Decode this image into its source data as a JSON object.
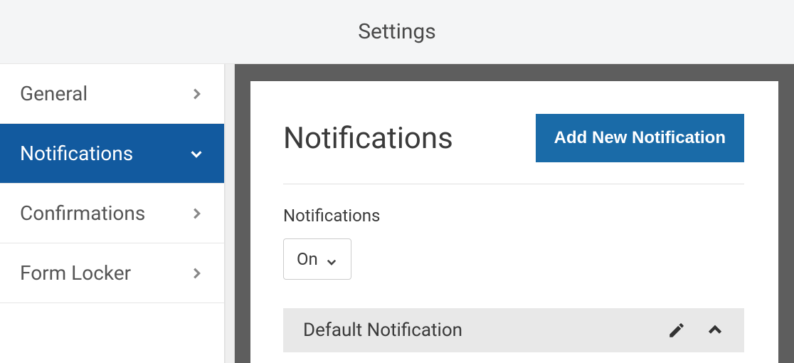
{
  "header": {
    "title": "Settings"
  },
  "sidebar": {
    "items": [
      {
        "label": "General"
      },
      {
        "label": "Notifications"
      },
      {
        "label": "Confirmations"
      },
      {
        "label": "Form Locker"
      }
    ]
  },
  "main": {
    "panel_title": "Notifications",
    "add_button": "Add New Notification",
    "section_label": "Notifications",
    "dropdown_value": "On",
    "item_title": "Default Notification"
  },
  "colors": {
    "accent": "#1a6ba8",
    "annotation": "#ed1c24"
  }
}
